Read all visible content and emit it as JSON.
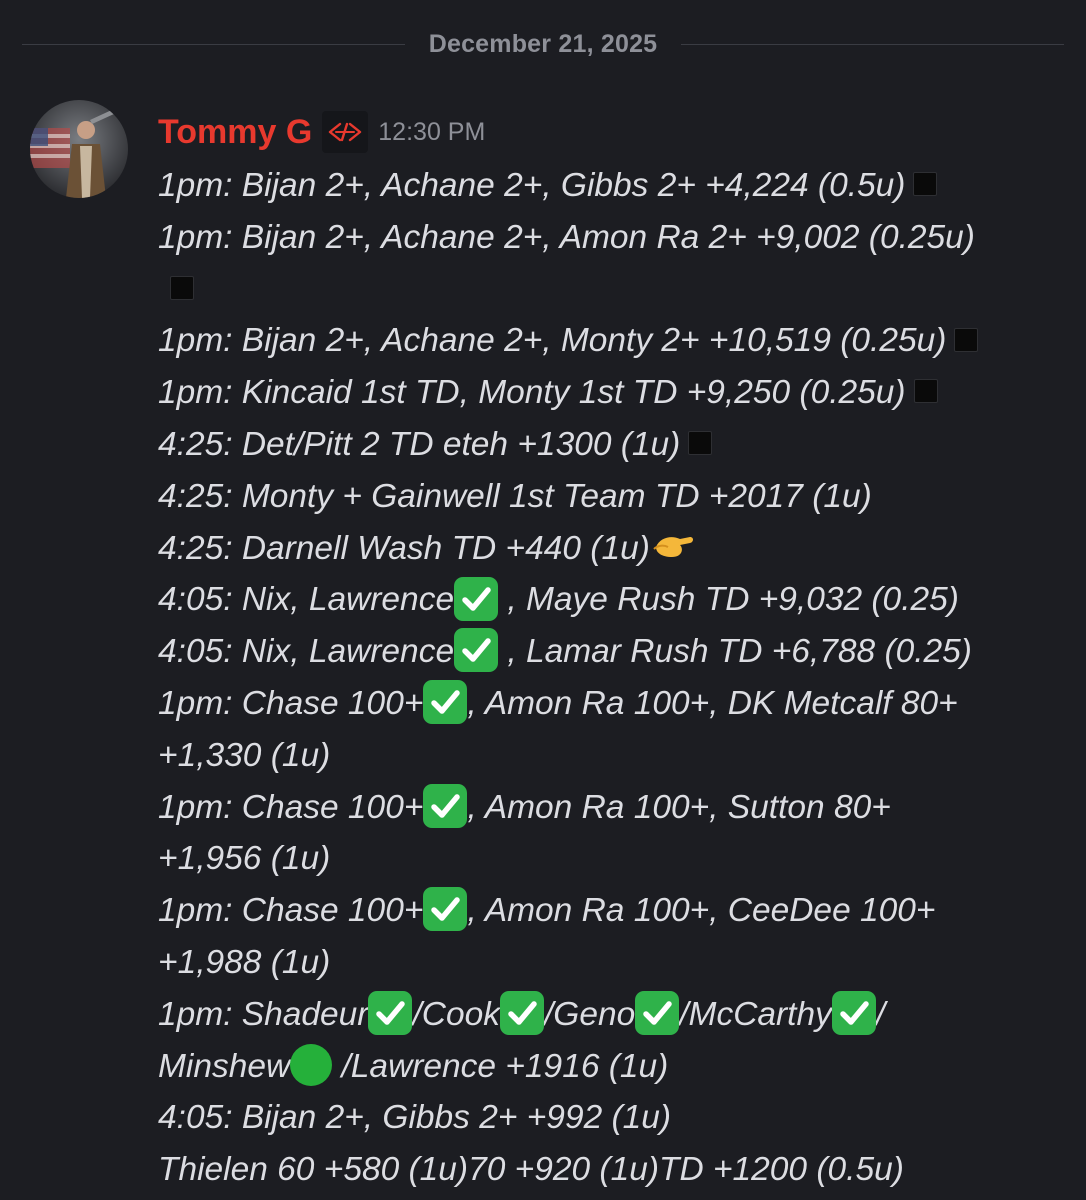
{
  "date_divider": "December 21, 2025",
  "message": {
    "username": "Tommy G",
    "timestamp": "12:30 PM",
    "avatar_icon": "avatar-patriot-soldier",
    "role_icon": "role-tag-icon",
    "lines": [
      [
        "1pm: Bijan 2+, Achane 2+, Gibbs 2+ +4,224 (0.5u)"
      ],
      [
        "1pm: Bijan 2+, Achane 2+, Amon Ra 2+ +9,002 (0.25u)"
      ],
      [
        ""
      ],
      [
        "1pm: Bijan 2+, Achane 2+, Monty 2+ +10,519 (0.25u)"
      ],
      [
        "1pm: Kincaid 1st TD, Monty 1st TD +9,250 (0.25u)"
      ],
      [
        "4:25: Det/Pitt 2 TD eteh +1300 (1u)"
      ],
      [
        "4:25: Monty + Gainwell 1st Team TD +2017 (1u)"
      ],
      [
        "4:25: Darnell Wash TD +440 (1u)"
      ],
      [
        "4:05: Nix, Lawrence",
        " , Maye Rush TD +9,032 (0.25)"
      ],
      [
        "4:05: Nix, Lawrence",
        " , Lamar Rush TD +6,788 (0.25)"
      ],
      [
        "1pm: Chase 100+",
        ", Amon Ra 100+, DK Metcalf 80+"
      ],
      [
        "+1,330 (1u)"
      ],
      [
        "1pm: Chase 100+",
        ", Amon Ra 100+, Sutton 80+"
      ],
      [
        "+1,956 (1u)"
      ],
      [
        "1pm: Chase 100+",
        ", Amon Ra 100+, CeeDee 100+"
      ],
      [
        "+1,988 (1u)"
      ],
      [
        "1pm: Shadeur",
        "/Cook",
        "/Geno",
        "/McCarthy",
        "/"
      ],
      [
        "Minshew",
        " /Lawrence +1916 (1u)"
      ],
      [
        "4:05: Bijan 2+, Gibbs 2+ +992 (1u)"
      ],
      [
        "Thielen 60 +580 (1u)70 +920 (1u)TD +1200 (0.5u)"
      ]
    ],
    "emojis": {
      "black_square": "black-square-emoji",
      "check": "white-check-mark-emoji",
      "green_circle": "green-circle-emoji",
      "pinch": "pinching-hand-emoji"
    }
  },
  "colors": {
    "background": "#1c1d22",
    "username": "#e8392e",
    "muted": "#8e9098",
    "text": "#dcdde2",
    "check_green": "#2fb24a"
  }
}
